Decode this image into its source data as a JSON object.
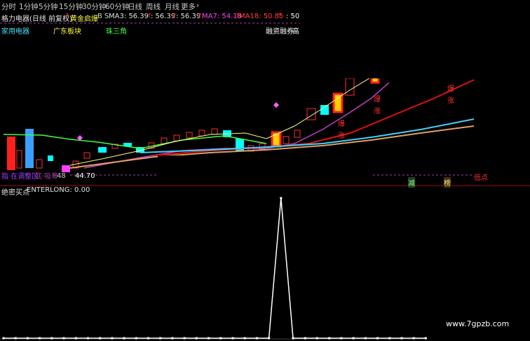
{
  "toolbar": {
    "items": [
      "分时",
      "1分钟",
      "5分钟",
      "15分钟",
      "30分钟",
      "60分钟",
      "日线",
      "周线",
      "月线",
      "更多",
      "›"
    ]
  },
  "ma_row": {
    "stock_title": "格力电器(日线 前复权)",
    "indicator_name": "黄金启爆",
    "bs_label": "B S",
    "ma3": "MA3: 56.39",
    "v2": ": 56.39",
    "v3": ": 56.39",
    "ma7": "MA7: 54.18",
    "ma18": "MA18: 50.85",
    "v6": ": 50.85",
    "colors": {
      "ma3": "#e0e0e0",
      "ma7": "#ff40ff",
      "ma18": "#ff4040",
      "v6": "#ffffff",
      "arrow": "#ff2020"
    }
  },
  "tags": {
    "sector": "家用电器",
    "region": "广东板块",
    "concept": "珠三角",
    "financing": "融资融券",
    "cut_word": "高"
  },
  "chart_labels": {
    "bao1": "爆",
    "zhang1": "涨",
    "bao2": "爆",
    "zhang2": "涨",
    "bao3": "爆",
    "zhang3": "涨",
    "low_point": "低点",
    "jian": "减",
    "bang": "榜",
    "lower_left_1": "指·在调整区",
    "lower_left_2": "底·吸筹",
    "lower_value": "44.70",
    "bottom_value": "48"
  },
  "sub_panel": {
    "title": "绝密买点",
    "value": "ENTERLONG: 0.00"
  },
  "watermark": "www.7gpzb.com",
  "chart_data": {
    "type": "line",
    "series": [
      {
        "name": "ENTERLONG",
        "values": [
          0,
          0,
          0,
          0,
          0,
          0,
          0,
          0,
          0,
          0,
          0,
          0,
          0,
          0,
          0,
          0,
          0,
          0,
          0,
          0,
          0,
          0,
          0,
          1,
          0,
          0,
          0,
          0,
          0,
          0,
          0,
          0,
          0,
          0,
          0,
          0,
          0,
          0,
          0,
          0,
          0,
          0,
          0,
          0
        ]
      }
    ],
    "ylim": [
      0,
      1
    ]
  }
}
